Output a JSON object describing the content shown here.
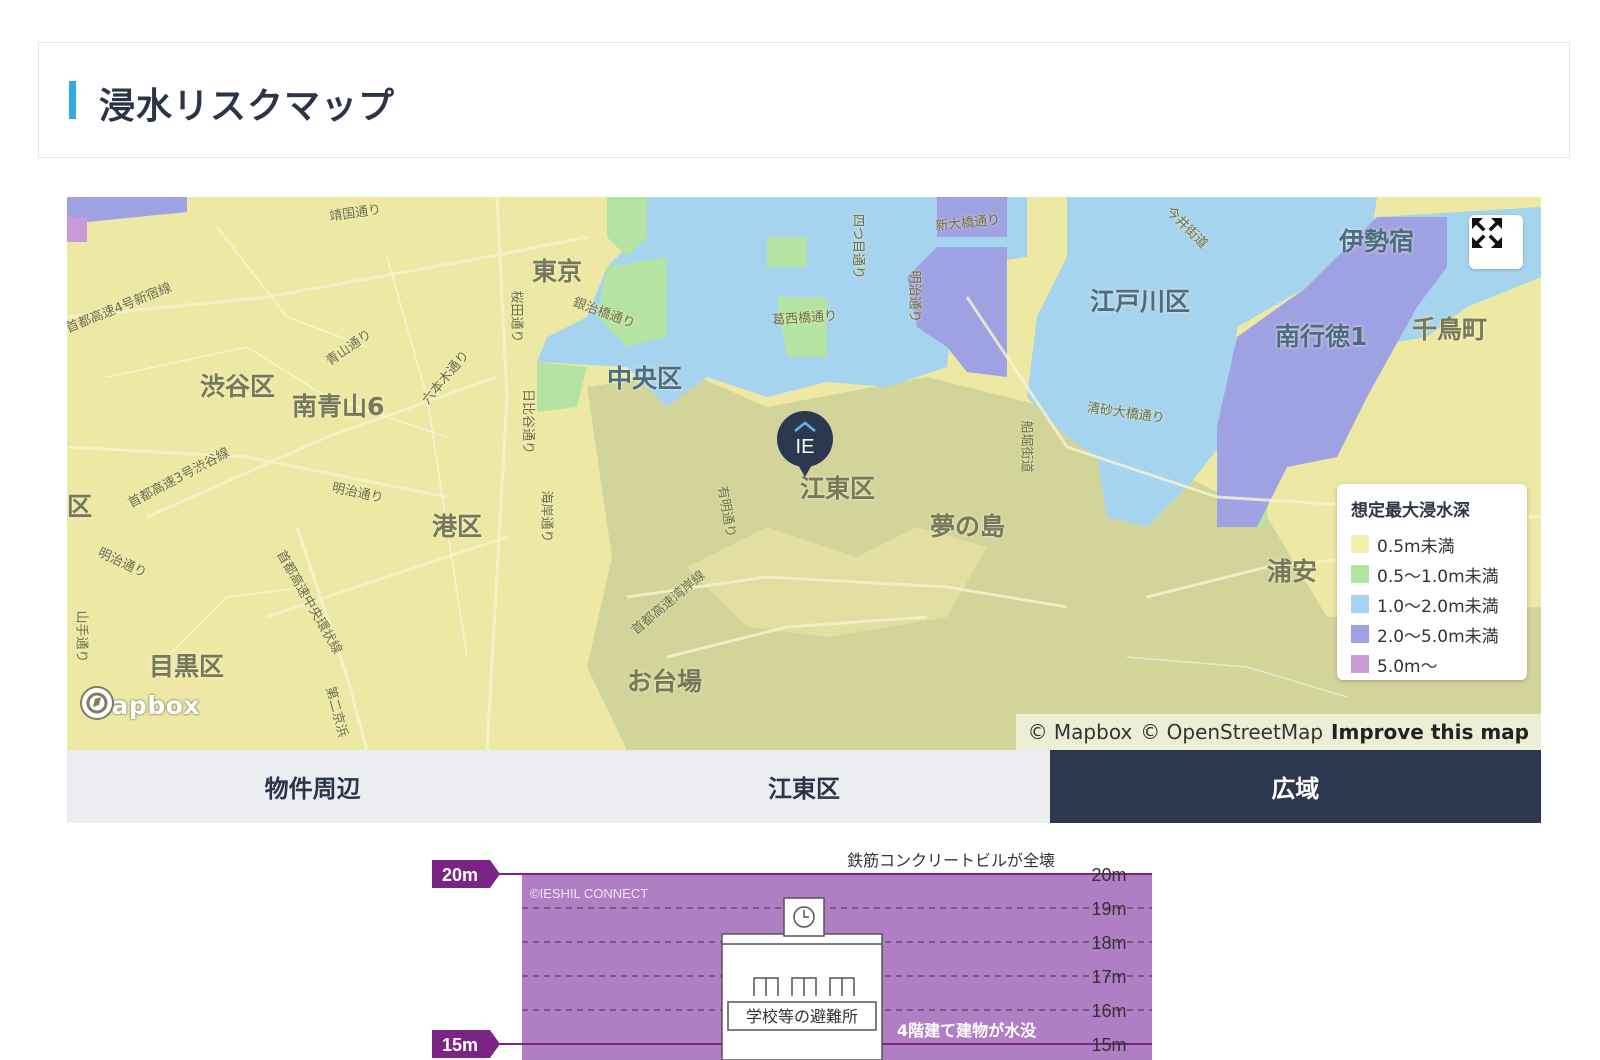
{
  "section": {
    "title": "浸水リスクマップ"
  },
  "map": {
    "area_labels": {
      "tokyo": "東京",
      "shibuya": "渋谷区",
      "minamiaoyama": "南青山6",
      "chuo": "中央区",
      "koto": "江東区",
      "minato": "港区",
      "yumenoshima": "夢の島",
      "meguro": "目黒区",
      "odaiba": "お台場",
      "edogawa": "江戸川区",
      "minamigyotoku": "南行徳1",
      "isejuku": "伊勢宿",
      "chidori": "千鳥町",
      "urayasu": "浦安",
      "ku": "区"
    },
    "road_labels": {
      "yasukuni": "靖国通り",
      "shuto4": "首都高速4号新宿線",
      "aoyama": "青山通り",
      "roppongi": "六本木通り",
      "shuto3": "首都高速3号渋谷線",
      "meiji": "明治通り",
      "meiji2": "明治通り",
      "sakurada": "桜田通り",
      "hibiya": "日比谷通り",
      "kaigan": "海岸通り",
      "ginza": "銀治橋通り",
      "kasai": "葛西橋通り",
      "yotsume": "四つ目通り",
      "shinohashi": "新大橋通り",
      "meiji3": "明治通り",
      "kiyosuna": "清砂大橋通り",
      "funabori": "船堀街道",
      "imai": "今井街道",
      "wangan": "首都高速湾岸線",
      "ariake": "有明通り",
      "chuokan": "首都高速中央環状線",
      "yamate": "山手通り",
      "daini": "第二京浜"
    },
    "legend": {
      "title": "想定最大浸水深",
      "items": [
        {
          "label": "0.5m未満",
          "color": "#f2eeab"
        },
        {
          "label": "0.5〜1.0m未満",
          "color": "#b5e3a3"
        },
        {
          "label": "1.0〜2.0m未満",
          "color": "#a6d3ee"
        },
        {
          "label": "2.0〜5.0m未満",
          "color": "#9ea1e2"
        },
        {
          "label": "5.0m〜",
          "color": "#c99ad6"
        }
      ]
    },
    "mapbox_logo": "mapbox",
    "attribution": {
      "mapbox": "© Mapbox",
      "osm": "© OpenStreetMap",
      "improve": "Improve this map"
    },
    "expand_icon": "expand-arrows-icon",
    "pin_text": "IE"
  },
  "tabs": [
    {
      "label": "物件周辺",
      "active": false
    },
    {
      "label": "江東区",
      "active": false
    },
    {
      "label": "広域",
      "active": true
    }
  ],
  "depth_chart": {
    "marker_top": "20m",
    "marker_bottom": "15m",
    "caption_top": "鉄筋コンクリートビルが全壊",
    "copyright": "©IESHIL CONNECT",
    "levels": [
      "20m",
      "19m",
      "18m",
      "17m",
      "16m",
      "15m"
    ],
    "building_label": "学校等の避難所",
    "caption_bottom": "4階建て建物が水没",
    "fill_color": "#b07ec2",
    "marker_color": "#7a2486"
  }
}
